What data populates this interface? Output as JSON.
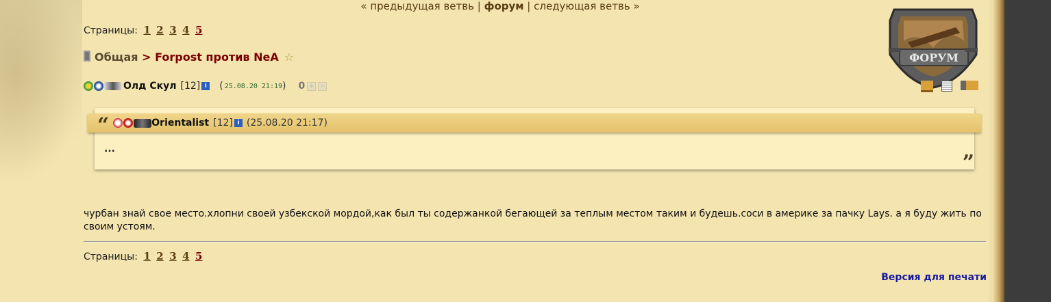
{
  "topnav": {
    "prev": "« предыдущая ветвь",
    "sep1": " | ",
    "forum": "форум",
    "sep2": " | ",
    "next": "следующая ветвь »"
  },
  "pages": {
    "label": "Страницы:",
    "items": [
      "1",
      "2",
      "3",
      "4",
      "5"
    ],
    "current": "5"
  },
  "breadcrumb": {
    "category": "Общая",
    "separator": " > ",
    "topic": "Forpost против NeA",
    "star": "☆"
  },
  "post": {
    "author": "Олд Скул",
    "level": "[12]",
    "info_icon": "i",
    "date_open": "(",
    "date": "25.08.20 21:19",
    "date_close": ")",
    "rating": "0",
    "plus": "+",
    "minus": "−",
    "quote": {
      "author": "Orientalist",
      "level": "[12]",
      "info_icon": "i",
      "date": "(25.08.20 21:17)",
      "text": "...",
      "open_mark": "“",
      "close_mark": "”"
    },
    "message": "чурбан знай свое место.хлопни своей узбекской мордой,как был ты содержанкой бегающей за теплым местом таким и будешь.соси в америке за пачку Lays. а я буду жить по своим устоям."
  },
  "footer": {
    "print_link": "Версия для печати"
  },
  "logo": {
    "text": "ФОРУМ"
  },
  "colors": {
    "background": "#f3e4b0",
    "link_brown": "#5a3e14",
    "topic_red": "#7a0000",
    "print_blue": "#1a1aa0",
    "quote_bar": "#e3c26b"
  }
}
